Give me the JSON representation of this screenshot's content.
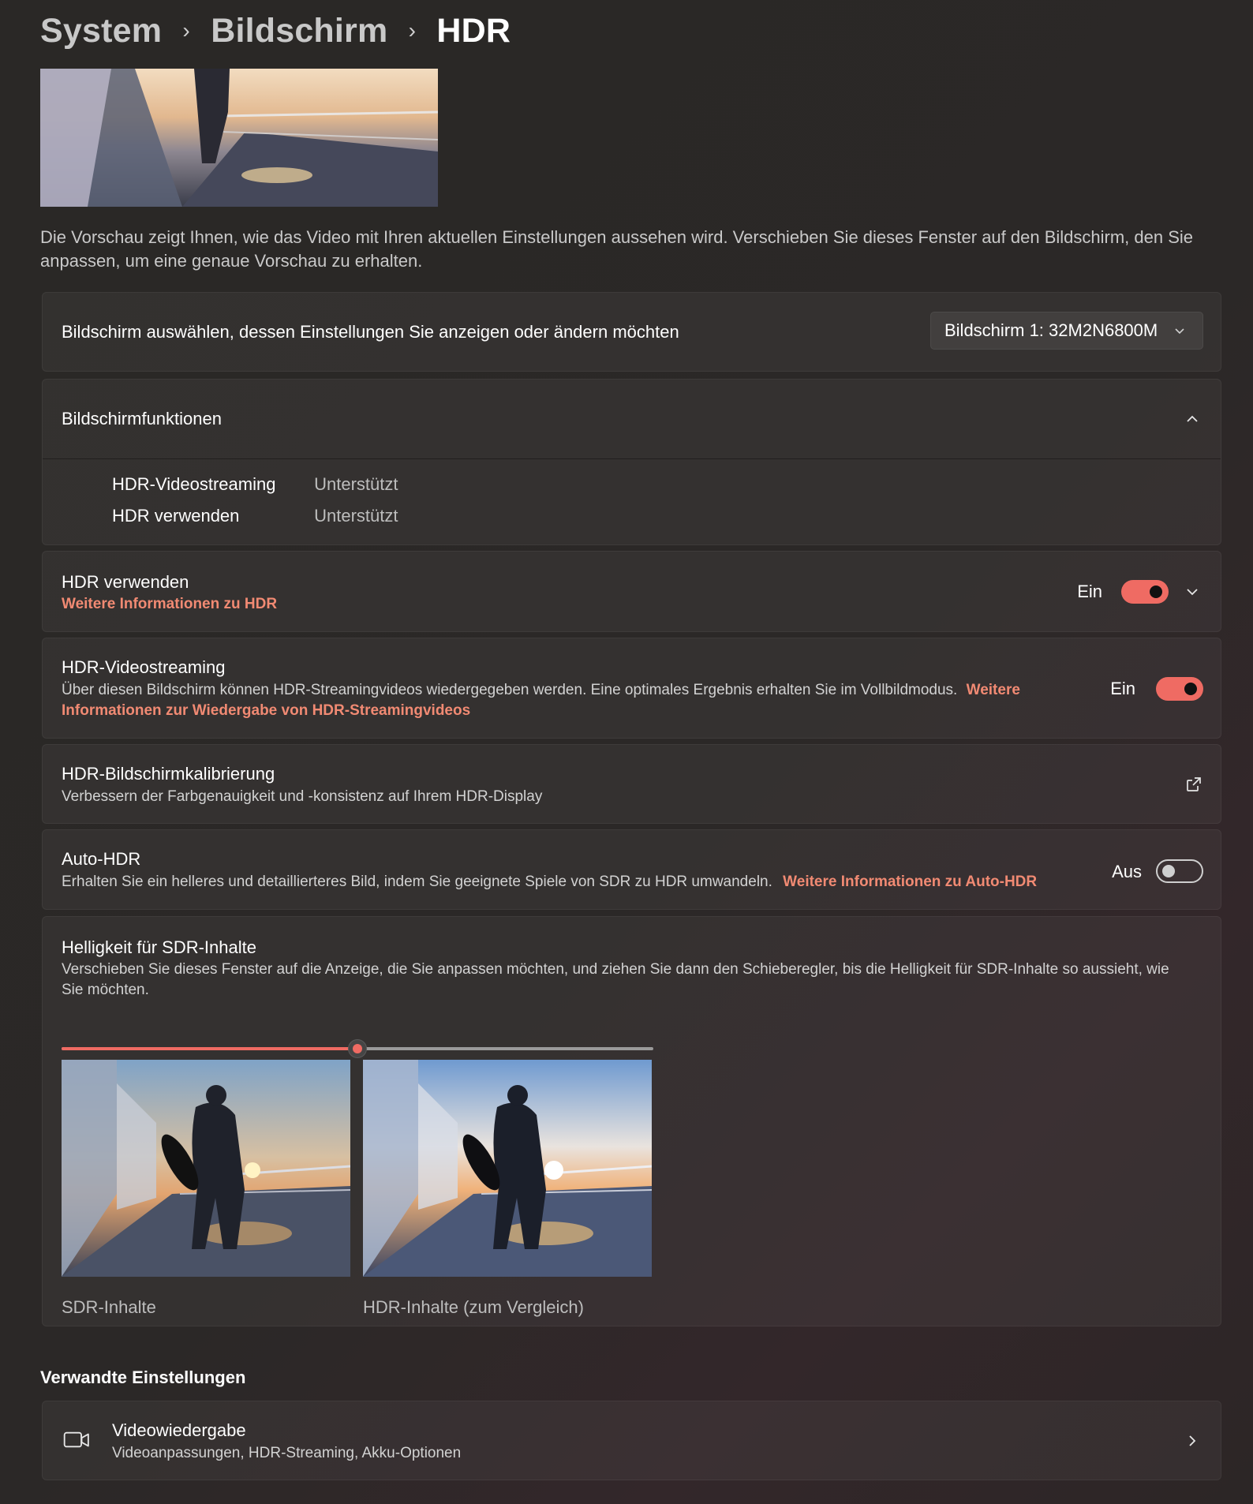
{
  "breadcrumb": {
    "items": [
      "System",
      "Bildschirm",
      "HDR"
    ],
    "separator": "›"
  },
  "preview": {
    "description": "Die Vorschau zeigt Ihnen, wie das Video mit Ihren aktuellen Einstellungen aussehen wird. Verschieben Sie dieses Fenster auf den Bildschirm, den Sie anpassen, um eine genaue Vorschau zu erhalten."
  },
  "display_select": {
    "label": "Bildschirm auswählen, dessen Einstellungen Sie anzeigen oder ändern möchten",
    "selected": "Bildschirm 1: 32M2N6800M"
  },
  "features": {
    "title": "Bildschirmfunktionen",
    "rows": [
      {
        "name": "HDR-Videostreaming",
        "value": "Unterstützt"
      },
      {
        "name": "HDR verwenden",
        "value": "Unterstützt"
      }
    ]
  },
  "use_hdr": {
    "title": "HDR verwenden",
    "link": "Weitere Informationen zu HDR",
    "state_label": "Ein",
    "on": true
  },
  "hdr_streaming": {
    "title": "HDR-Videostreaming",
    "description": "Über diesen Bildschirm können HDR-Streamingvideos wiedergegeben werden. Eine optimales Ergebnis erhalten Sie im Vollbildmodus.",
    "link_part1": "Weitere",
    "link_part2": "Informationen zur Wiedergabe von HDR-Streamingvideos",
    "state_label": "Ein",
    "on": true
  },
  "calibration": {
    "title": "HDR-Bildschirmkalibrierung",
    "description": "Verbessern der Farbgenauigkeit und -konsistenz auf Ihrem HDR-Display"
  },
  "auto_hdr": {
    "title": "Auto-HDR",
    "description": "Erhalten Sie ein helleres und detaillierteres Bild, indem Sie geeignete Spiele von SDR zu HDR umwandeln.",
    "link": "Weitere Informationen zu Auto-HDR",
    "state_label": "Aus",
    "on": false
  },
  "sdr_brightness": {
    "title": "Helligkeit für SDR-Inhalte",
    "description": "Verschieben Sie dieses Fenster auf die Anzeige, die Sie anpassen möchten, und ziehen Sie dann den Schieberegler, bis die Helligkeit für SDR-Inhalte so aussieht, wie Sie möchten.",
    "slider_value_fraction": 0.5,
    "sdr_label": "SDR-Inhalte",
    "hdr_label": "HDR-Inhalte (zum Vergleich)"
  },
  "related": {
    "heading": "Verwandte Einstellungen",
    "items": [
      {
        "title": "Videowiedergabe",
        "description": "Videoanpassungen, HDR-Streaming, Akku-Optionen",
        "icon": "video-camera-icon"
      }
    ]
  },
  "colors": {
    "accent": "#ef6b63",
    "link": "#f18a73",
    "background": "#2a2826"
  }
}
